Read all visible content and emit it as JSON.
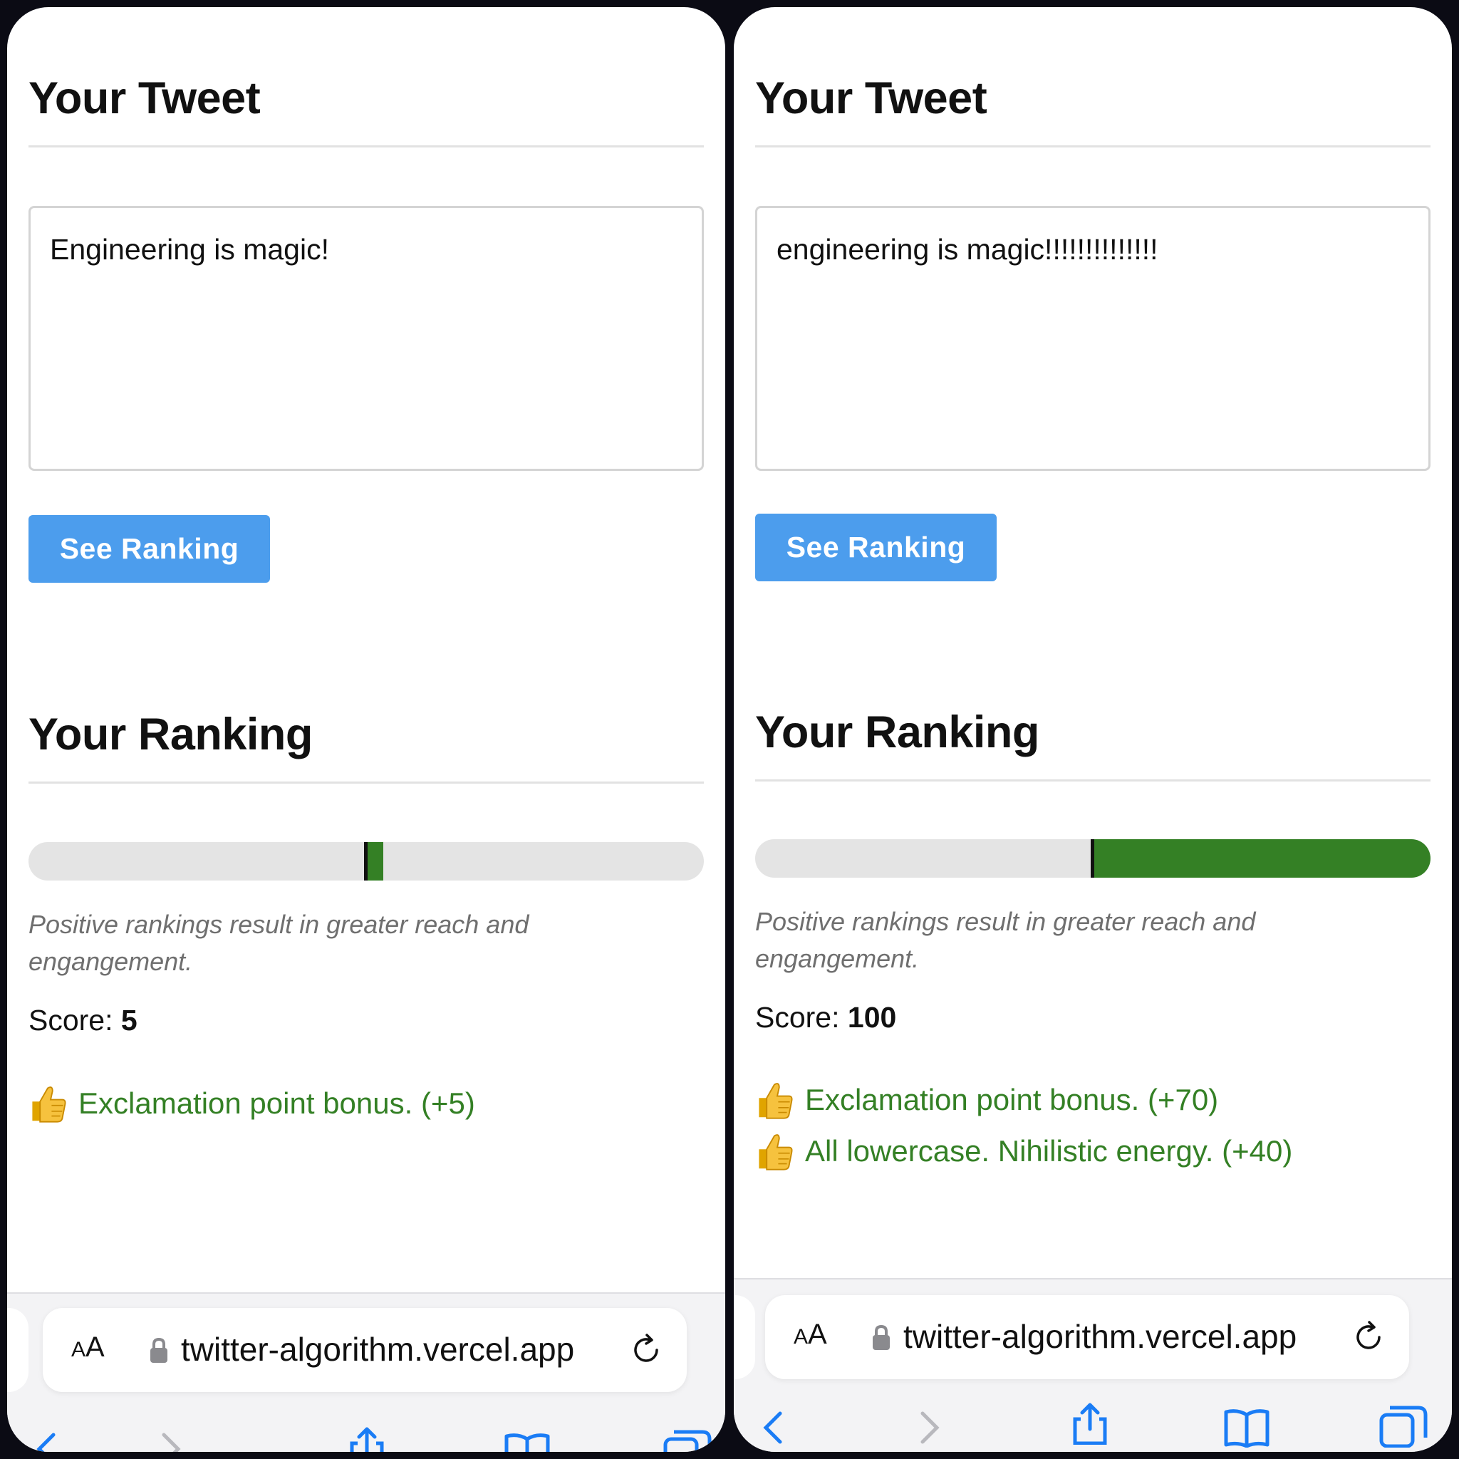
{
  "colors": {
    "accent_button": "#4c9ded",
    "positive_green": "#348025",
    "meter_track": "#e4e4e4"
  },
  "panels": [
    {
      "tweet_heading": "Your Tweet",
      "tweet_text": "Engineering is magic!",
      "button_label": "See Ranking",
      "ranking_heading": "Your Ranking",
      "meter_score": 5,
      "meter_range": [
        -100,
        100
      ],
      "note": "Positive rankings result in greater reach and engangement.",
      "score_label": "Score:",
      "score_value": "5",
      "reasons": [
        {
          "icon": "thumbs-up-icon",
          "text": "Exclamation point bonus. (+5)"
        }
      ],
      "browser": {
        "aa_small": "A",
        "aa_big": "A",
        "url": "twitter-algorithm.vercel.app"
      }
    },
    {
      "tweet_heading": "Your Tweet",
      "tweet_text": "engineering is magic!!!!!!!!!!!!!!",
      "button_label": "See Ranking",
      "ranking_heading": "Your Ranking",
      "meter_score": 100,
      "meter_range": [
        -100,
        100
      ],
      "note": "Positive rankings result in greater reach and engangement.",
      "score_label": "Score:",
      "score_value": "100",
      "reasons": [
        {
          "icon": "thumbs-up-icon",
          "text": "Exclamation point bonus. (+70)"
        },
        {
          "icon": "thumbs-up-icon",
          "text": "All lowercase. Nihilistic energy. (+40)"
        }
      ],
      "browser": {
        "aa_small": "A",
        "aa_big": "A",
        "url": "twitter-algorithm.vercel.app"
      }
    }
  ]
}
